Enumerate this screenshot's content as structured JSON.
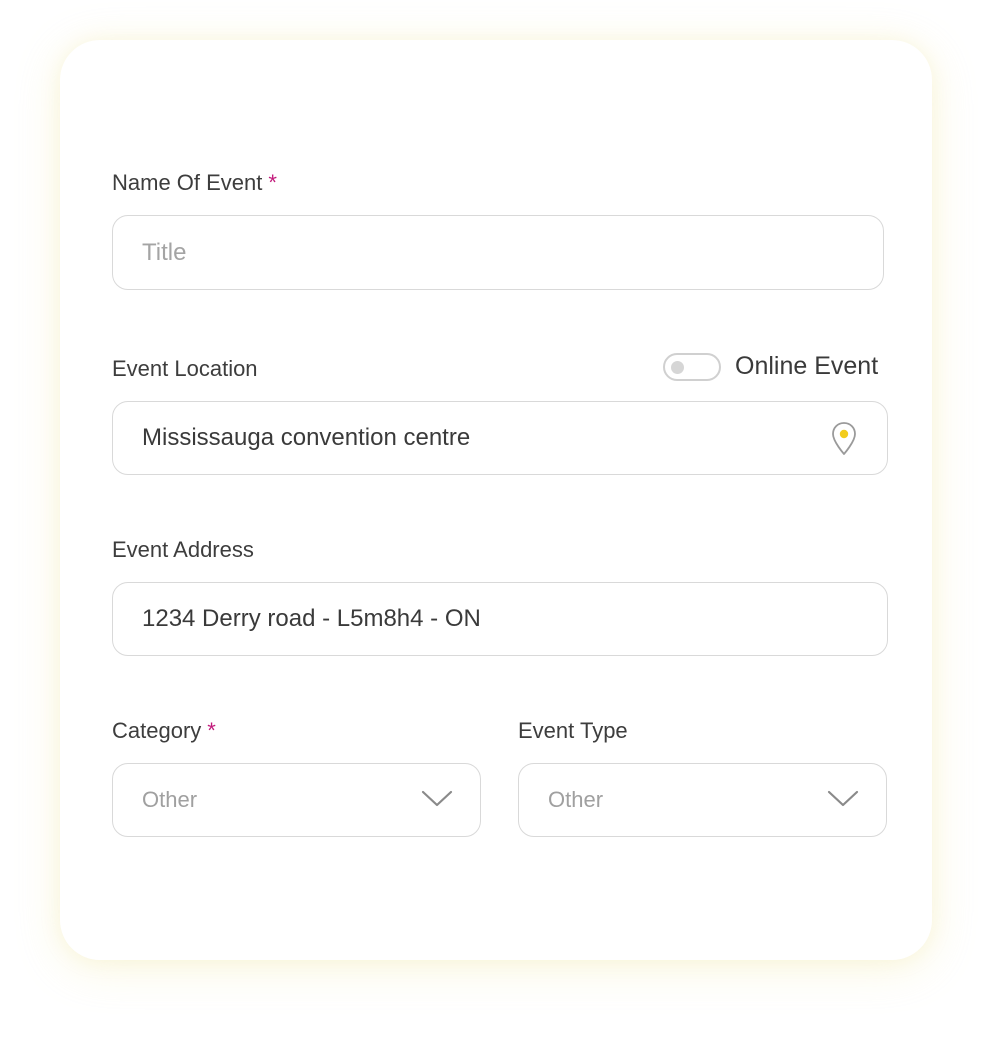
{
  "form": {
    "name": {
      "label": "Name Of Event",
      "required_mark": "*",
      "placeholder": "Title",
      "value": ""
    },
    "location": {
      "label": "Event Location",
      "value": "Mississauga convention centre",
      "icon": "location-pin-icon"
    },
    "online": {
      "label": "Online Event",
      "checked": false
    },
    "address": {
      "label": "Event Address",
      "value": "1234 Derry road - L5m8h4 - ON"
    },
    "category": {
      "label": "Category",
      "required_mark": "*",
      "value": "Other",
      "icon": "chevron-down-icon"
    },
    "event_type": {
      "label": "Event Type",
      "value": "Other",
      "icon": "chevron-down-icon"
    }
  },
  "colors": {
    "required": "#c21a7b",
    "pin_accent": "#f2cc1c",
    "border": "#d9d9d9",
    "label_text": "#3d3d3d",
    "placeholder_text": "#a4a4a4"
  }
}
